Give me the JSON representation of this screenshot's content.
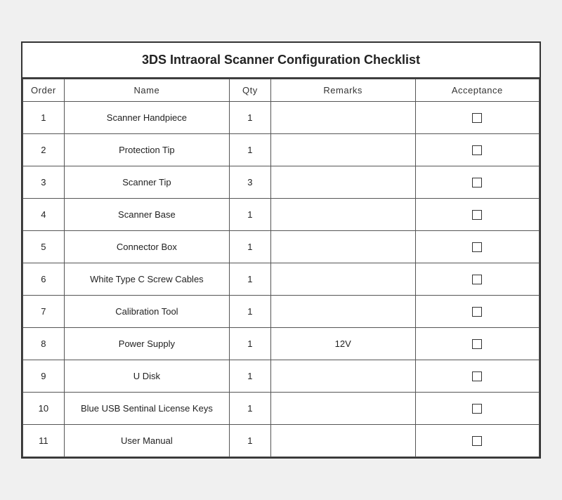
{
  "title": "3DS Intraoral Scanner Configuration Checklist",
  "columns": {
    "order": "Order",
    "name": "Name",
    "qty": "Qty",
    "remarks": "Remarks",
    "acceptance": "Acceptance"
  },
  "rows": [
    {
      "order": "1",
      "name": "Scanner Handpiece",
      "qty": "1",
      "remarks": "",
      "acceptance": ""
    },
    {
      "order": "2",
      "name": "Protection Tip",
      "qty": "1",
      "remarks": "",
      "acceptance": ""
    },
    {
      "order": "3",
      "name": "Scanner Tip",
      "qty": "3",
      "remarks": "",
      "acceptance": ""
    },
    {
      "order": "4",
      "name": "Scanner Base",
      "qty": "1",
      "remarks": "",
      "acceptance": ""
    },
    {
      "order": "5",
      "name": "Connector Box",
      "qty": "1",
      "remarks": "",
      "acceptance": ""
    },
    {
      "order": "6",
      "name": "White Type C Screw Cables",
      "qty": "1",
      "remarks": "",
      "acceptance": ""
    },
    {
      "order": "7",
      "name": "Calibration Tool",
      "qty": "1",
      "remarks": "",
      "acceptance": ""
    },
    {
      "order": "8",
      "name": "Power Supply",
      "qty": "1",
      "remarks": "12V",
      "acceptance": ""
    },
    {
      "order": "9",
      "name": "U Disk",
      "qty": "1",
      "remarks": "",
      "acceptance": ""
    },
    {
      "order": "10",
      "name": "Blue USB Sentinal License Keys",
      "qty": "1",
      "remarks": "",
      "acceptance": ""
    },
    {
      "order": "11",
      "name": "User Manual",
      "qty": "1",
      "remarks": "",
      "acceptance": ""
    }
  ]
}
